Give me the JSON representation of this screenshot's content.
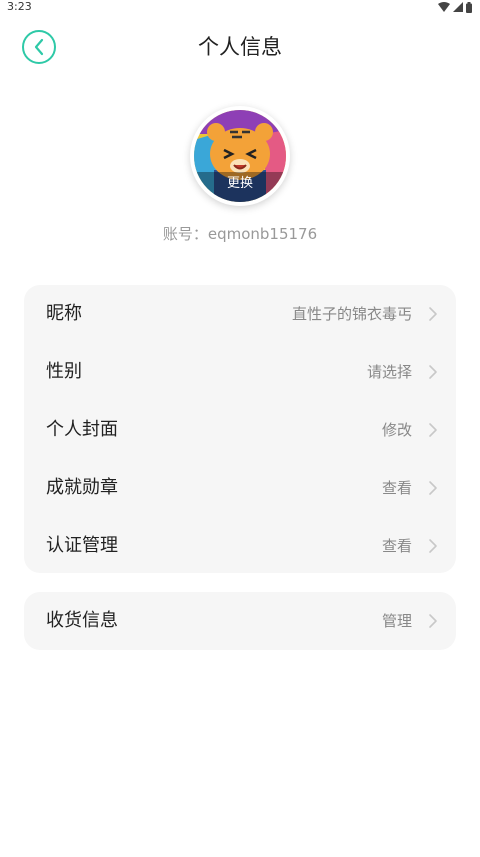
{
  "status_bar": {
    "time": "3:23"
  },
  "header": {
    "title": "个人信息"
  },
  "avatar": {
    "change_label": "更换"
  },
  "account": {
    "text": "账号：eqmonb15176"
  },
  "menu": [
    {
      "label": "昵称",
      "value": "直性子的锦衣毒丐"
    },
    {
      "label": "性别",
      "value": "请选择"
    },
    {
      "label": "个人封面",
      "value": "修改"
    },
    {
      "label": "成就勋章",
      "value": "查看"
    },
    {
      "label": "认证管理",
      "value": "查看"
    }
  ],
  "menu2": [
    {
      "label": "收货信息",
      "value": "管理"
    }
  ],
  "colors": {
    "accent": "#2ec9a7",
    "card_bg": "#f6f6f6"
  }
}
